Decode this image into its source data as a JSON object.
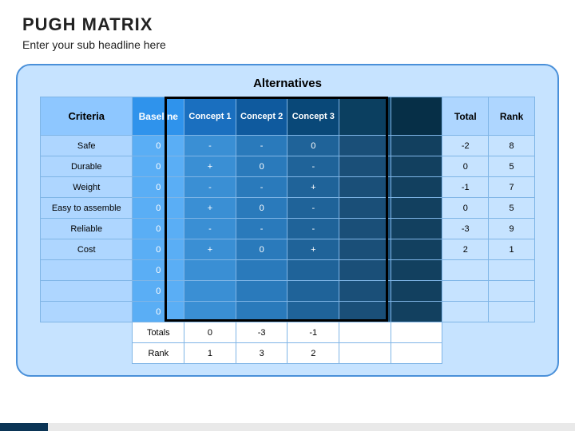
{
  "title": "PUGH MATRIX",
  "subtitle": "Enter your sub headline here",
  "alternatives_label": "Alternatives",
  "headers": {
    "criteria": "Criteria",
    "baseline": "Baseline",
    "c1": "Concept 1",
    "c2": "Concept 2",
    "c3": "Concept 3",
    "total": "Total",
    "rank": "Rank"
  },
  "rows": [
    {
      "crit": "Safe",
      "base": "0",
      "c1": "-",
      "c2": "-",
      "c3": "0",
      "total": "-2",
      "rank": "8"
    },
    {
      "crit": "Durable",
      "base": "0",
      "c1": "+",
      "c2": "0",
      "c3": "-",
      "total": "0",
      "rank": "5"
    },
    {
      "crit": "Weight",
      "base": "0",
      "c1": "-",
      "c2": "-",
      "c3": "+",
      "total": "-1",
      "rank": "7"
    },
    {
      "crit": "Easy to assemble",
      "base": "0",
      "c1": "+",
      "c2": "0",
      "c3": "-",
      "total": "0",
      "rank": "5"
    },
    {
      "crit": "Reliable",
      "base": "0",
      "c1": "-",
      "c2": "-",
      "c3": "-",
      "total": "-3",
      "rank": "9"
    },
    {
      "crit": "Cost",
      "base": "0",
      "c1": "+",
      "c2": "0",
      "c3": "+",
      "total": "2",
      "rank": "1"
    },
    {
      "crit": "",
      "base": "0",
      "c1": "",
      "c2": "",
      "c3": "",
      "total": "",
      "rank": ""
    },
    {
      "crit": "",
      "base": "0",
      "c1": "",
      "c2": "",
      "c3": "",
      "total": "",
      "rank": ""
    },
    {
      "crit": "",
      "base": "0",
      "c1": "",
      "c2": "",
      "c3": "",
      "total": "",
      "rank": ""
    }
  ],
  "totals": {
    "label": "Totals",
    "c1": "0",
    "c2": "-3",
    "c3": "-1"
  },
  "ranks": {
    "label": "Rank",
    "c1": "1",
    "c2": "3",
    "c3": "2"
  }
}
